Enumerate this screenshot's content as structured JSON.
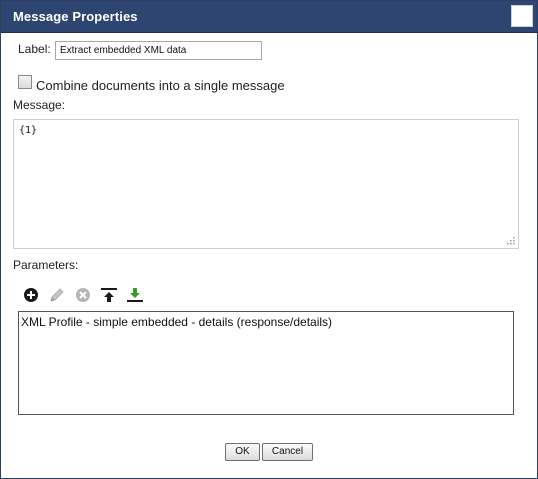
{
  "dialog": {
    "title": "Message Properties"
  },
  "form": {
    "label_caption": "Label:",
    "label_value": "Extract embedded XML data",
    "combine_label": "Combine documents into a single message",
    "combine_checked": false,
    "message_caption": "Message:",
    "message_value": "{1}",
    "parameters_caption": "Parameters:"
  },
  "toolbar": {
    "icons": [
      "add-icon",
      "edit-icon",
      "delete-icon",
      "move-to-top-icon",
      "move-to-bottom-icon"
    ]
  },
  "parameters": {
    "items": [
      "XML Profile - simple embedded - details (response/details)"
    ]
  },
  "buttons": {
    "ok": "OK",
    "cancel": "Cancel"
  },
  "colors": {
    "titlebar": "#2e4471",
    "add_icon": "#1a1a1a",
    "disabled_icon": "#b5b5b5",
    "move_bottom_arrow": "#3a9a2a"
  }
}
